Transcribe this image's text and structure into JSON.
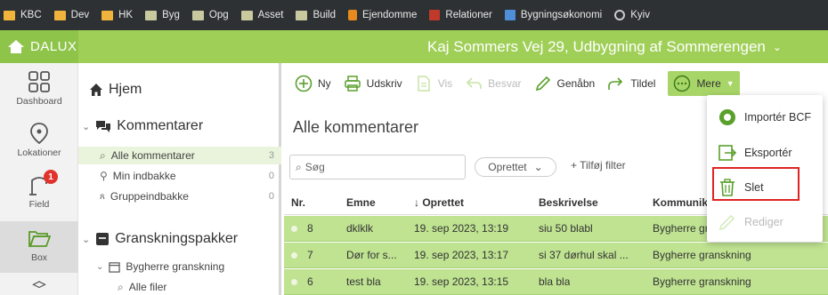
{
  "bookmarks": [
    {
      "label": "KBC",
      "icon": "folder-icon"
    },
    {
      "label": "Dev",
      "icon": "folder-icon"
    },
    {
      "label": "HK",
      "icon": "folder-icon"
    },
    {
      "label": "Byg",
      "icon": "folder-icon"
    },
    {
      "label": "Opg",
      "icon": "folder-icon"
    },
    {
      "label": "Asset",
      "icon": "folder-icon"
    },
    {
      "label": "Build",
      "icon": "folder-icon"
    },
    {
      "label": "Ejendomme",
      "icon": "site-icon"
    },
    {
      "label": "Relationer",
      "icon": "site-icon"
    },
    {
      "label": "Bygningsøkonomi",
      "icon": "site-icon"
    },
    {
      "label": "Kyiv",
      "icon": "globe-icon"
    }
  ],
  "header": {
    "logo": "DALUX",
    "project": "Kaj Sommers Vej 29, Udbygning af Sommerengen",
    "chevron": "⌄"
  },
  "rail": {
    "dashboard": "Dashboard",
    "lokationer": "Lokationer",
    "field": "Field",
    "field_badge": "1",
    "box": "Box"
  },
  "tree": {
    "hjem": "Hjem",
    "kommentarer": "Kommentarer",
    "alle_kommentarer": "Alle kommentarer",
    "alle_kommentarer_count": "3",
    "min_indbakke": "Min indbakke",
    "min_indbakke_count": "0",
    "gruppeindbakke": "Gruppeindbakke",
    "gruppeindbakke_count": "0",
    "granskningspakker": "Granskningspakker",
    "bygherre_granskning": "Bygherre granskning",
    "alle_filer": "Alle filer"
  },
  "toolbar": {
    "ny": "Ny",
    "udskriv": "Udskriv",
    "vis": "Vis",
    "besvar": "Besvar",
    "genaabn": "Genåbn",
    "tildel": "Tildel",
    "mere": "Mere"
  },
  "main": {
    "title": "Alle kommentarer",
    "search_placeholder": "Søg",
    "sort_pill": "Oprettet",
    "add_filter": "+ Tilføj filter"
  },
  "table": {
    "headers": {
      "nr": "Nr.",
      "emne": "Emne",
      "oprettet": "↓ Oprettet",
      "beskrivelse": "Beskrivelse",
      "kommunikation": "Kommunika"
    },
    "rows": [
      {
        "nr": "8",
        "emne": "dklklk",
        "oprettet": "19. sep 2023, 13:19",
        "beskrivelse": "siu 50 blabl",
        "gruppe": "Bygherre gr"
      },
      {
        "nr": "7",
        "emne": "Dør for s...",
        "oprettet": "19. sep 2023, 13:17",
        "beskrivelse": "si 37 dørhul skal ...",
        "gruppe": "Bygherre granskning"
      },
      {
        "nr": "6",
        "emne": "test bla",
        "oprettet": "19. sep 2023, 13:15",
        "beskrivelse": "bla bla",
        "gruppe": "Bygherre granskning"
      }
    ]
  },
  "dropdown": {
    "importer": "Importér BCF",
    "eksporter": "Eksportér",
    "slet": "Slet",
    "rediger": "Rediger"
  },
  "colors": {
    "brand_green": "#9fcf57",
    "row_green": "#bfe391",
    "highlight_red": "#e02323"
  }
}
